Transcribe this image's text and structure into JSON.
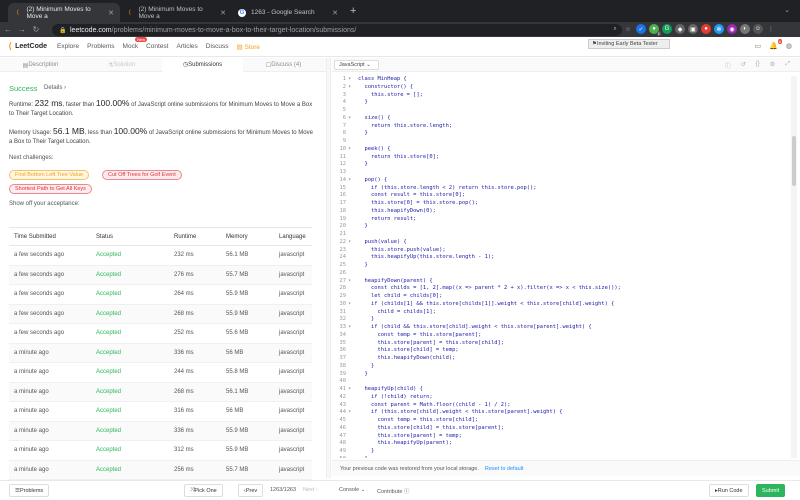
{
  "browser": {
    "tabs": [
      {
        "title": "(2) Minimum Moves to Move a",
        "icon": "leetcode-icon"
      },
      {
        "title": "(2) Minimum Moves to Move a",
        "icon": "leetcode-icon"
      },
      {
        "title": "1263 - Google Search",
        "icon": "google-icon"
      }
    ],
    "url_host": "leetcode.com",
    "url_path": "/problems/minimum-moves-to-move-a-box-to-their-target-location/submissions/",
    "ext_badge": "1"
  },
  "nav": {
    "logo": "LeetCode",
    "links": [
      "Explore",
      "Problems",
      "Mock",
      "Contest",
      "Articles",
      "Discuss",
      "Store"
    ],
    "mock_badge": "New",
    "beta_text": "Inviting Early Beta Tester",
    "notif_count": "6"
  },
  "left_tabs": [
    {
      "label": "Description"
    },
    {
      "label": "Solution"
    },
    {
      "label": "Submissions"
    },
    {
      "label": "Discuss (4)"
    }
  ],
  "result": {
    "status": "Success",
    "details": "Details",
    "runtime_prefix": "Runtime: ",
    "runtime_value": "232 ms",
    "runtime_mid": ", faster than ",
    "runtime_pct": "100.00%",
    "runtime_suffix": " of JavaScript online submissions for Minimum Moves to Move a Box to Their Target Location.",
    "memory_prefix": "Memory Usage: ",
    "memory_value": "56.1 MB",
    "memory_mid": ", less than ",
    "memory_pct": "100.00%",
    "memory_suffix": " of JavaScript online submissions for Minimum Moves to Move a Box to Their Target Location.",
    "next_label": "Next challenges:",
    "challenges": [
      "Find Bottom Left Tree Value",
      "Cut Off Trees for Golf Event",
      "Shortest Path to Get All Keys"
    ],
    "show_off": "Show off your acceptance:"
  },
  "table": {
    "headers": [
      "Time Submitted",
      "Status",
      "Runtime",
      "Memory",
      "Language"
    ],
    "rows": [
      [
        "a few seconds ago",
        "Accepted",
        "232 ms",
        "56.1 MB",
        "javascript"
      ],
      [
        "a few seconds ago",
        "Accepted",
        "276 ms",
        "55.7 MB",
        "javascript"
      ],
      [
        "a few seconds ago",
        "Accepted",
        "264 ms",
        "55.9 MB",
        "javascript"
      ],
      [
        "a few seconds ago",
        "Accepted",
        "268 ms",
        "55.9 MB",
        "javascript"
      ],
      [
        "a few seconds ago",
        "Accepted",
        "252 ms",
        "55.6 MB",
        "javascript"
      ],
      [
        "a minute ago",
        "Accepted",
        "336 ms",
        "56 MB",
        "javascript"
      ],
      [
        "a minute ago",
        "Accepted",
        "244 ms",
        "55.8 MB",
        "javascript"
      ],
      [
        "a minute ago",
        "Accepted",
        "268 ms",
        "56.1 MB",
        "javascript"
      ],
      [
        "a minute ago",
        "Accepted",
        "316 ms",
        "56 MB",
        "javascript"
      ],
      [
        "a minute ago",
        "Accepted",
        "336 ms",
        "55.9 MB",
        "javascript"
      ],
      [
        "a minute ago",
        "Accepted",
        "312 ms",
        "55.9 MB",
        "javascript"
      ],
      [
        "a minute ago",
        "Accepted",
        "256 ms",
        "55.7 MB",
        "javascript"
      ]
    ]
  },
  "editor": {
    "language": "JavaScript",
    "lines": [
      "class MinHeap {",
      "  constructor() {",
      "    this.store = [];",
      "  }",
      "",
      "  size() {",
      "    return this.store.length;",
      "  }",
      "",
      "  peek() {",
      "    return this.store[0];",
      "  }",
      "",
      "  pop() {",
      "    if (this.store.length < 2) return this.store.pop();",
      "    const result = this.store[0];",
      "    this.store[0] = this.store.pop();",
      "    this.heapifyDown(0);",
      "    return result;",
      "  }",
      "",
      "  push(value) {",
      "    this.store.push(value);",
      "    this.heapifyUp(this.store.length - 1);",
      "  }",
      "",
      "  heapifyDown(parent) {",
      "    const childs = [1, 2].map((x => parent * 2 + x).filter(x => x < this.size());",
      "    let child = childs[0];",
      "    if (childs[1] && this.store[childs[1]].weight < this.store[child].weight) {",
      "      child = childs[1];",
      "    }",
      "    if (child && this.store[child].weight < this.store[parent].weight) {",
      "      const temp = this.store[parent];",
      "      this.store[parent] = this.store[child];",
      "      this.store[child] = temp;",
      "      this.heapifyDown(child);",
      "    }",
      "  }",
      "",
      "  heapifyUp(child) {",
      "    if (!child) return;",
      "    const parent = Math.floor((child - 1) / 2);",
      "    if (this.store[child].weight < this.store[parent].weight) {",
      "      const temp = this.store[child];",
      "      this.store[child] = this.store[parent];",
      "      this.store[parent] = temp;",
      "      this.heapifyUp(parent);",
      "    }",
      "  }"
    ],
    "restored_msg": "Your previous code was restored from your local storage.",
    "reset_label": "Reset to default"
  },
  "bottom": {
    "problems": "Problems",
    "pick_one": "Pick One",
    "prev": "Prev",
    "page": "1263/1263",
    "next": "Next",
    "console": "Console",
    "contribute": "Contribute",
    "run": "Run Code",
    "submit": "Submit"
  }
}
